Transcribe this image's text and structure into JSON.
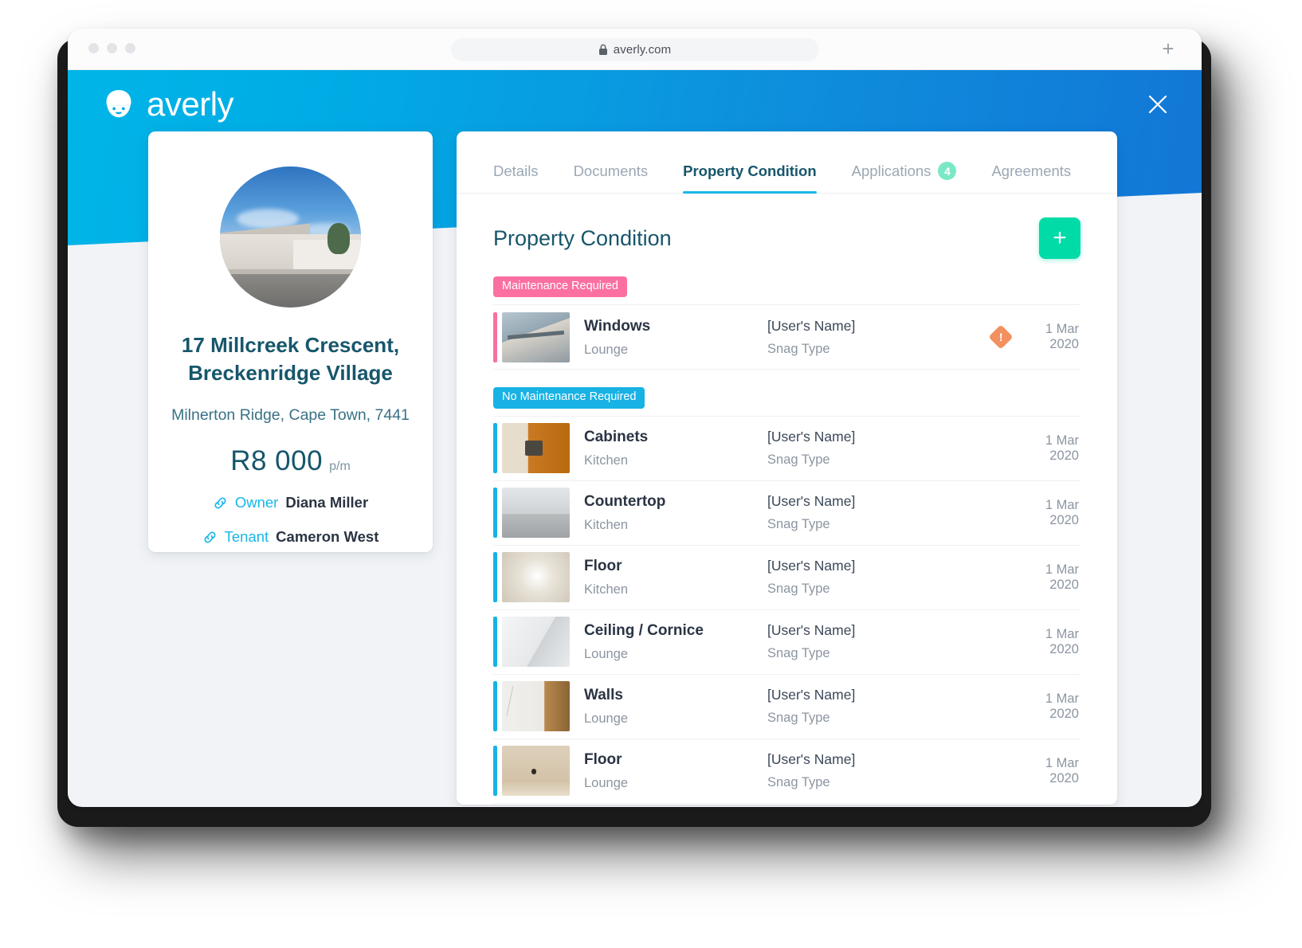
{
  "browser": {
    "url": "averly.com",
    "lock_icon": "lock-icon",
    "new_tab_label": "+",
    "traffic_lights": [
      "close",
      "minimize",
      "maximize"
    ]
  },
  "header": {
    "brand_name": "averly",
    "brand_icon": "averly-face-logo-icon",
    "close_icon": "close-icon",
    "gradient_from": "#00b5e8",
    "gradient_to": "#1276d6"
  },
  "property_card": {
    "photo_icon": "property-photo",
    "address": "17 Millcreek Crescent, Breckenridge Village",
    "locality": "Milnerton Ridge, Cape Town, 7441",
    "price": "R8 000",
    "price_period": "p/m",
    "people": [
      {
        "icon": "link-icon",
        "role": "Owner",
        "name": "Diana Miller"
      },
      {
        "icon": "link-icon",
        "role": "Tenant",
        "name": "Cameron West"
      }
    ]
  },
  "tabs": [
    {
      "label": "Details",
      "active": false,
      "badge": null
    },
    {
      "label": "Documents",
      "active": false,
      "badge": null
    },
    {
      "label": "Property Condition",
      "active": true,
      "badge": null
    },
    {
      "label": "Applications",
      "active": false,
      "badge": "4"
    },
    {
      "label": "Agreements",
      "active": false,
      "badge": null
    }
  ],
  "section": {
    "title": "Property Condition",
    "add_button_label": "+",
    "add_button_icon": "plus-icon",
    "add_button_color": "#00dba8"
  },
  "groups": [
    {
      "badge_label": "Maintenance Required",
      "badge_color": "#fb6fa1",
      "accent": "pink",
      "rows": [
        {
          "thumb": "th-windows",
          "title": "Windows",
          "subtitle": "Lounge",
          "user": "[User's Name]",
          "snag": "Snag Type",
          "alert": true,
          "alert_icon": "warning-diamond-icon",
          "date": "1 Mar 2020"
        }
      ]
    },
    {
      "badge_label": "No Maintenance Required",
      "badge_color": "#18b2e4",
      "accent": "blue",
      "rows": [
        {
          "thumb": "th-cabinets",
          "title": "Cabinets",
          "subtitle": "Kitchen",
          "user": "[User's Name]",
          "snag": "Snag Type",
          "alert": false,
          "date": "1 Mar 2020"
        },
        {
          "thumb": "th-countertop",
          "title": "Countertop",
          "subtitle": "Kitchen",
          "user": "[User's Name]",
          "snag": "Snag Type",
          "alert": false,
          "date": "1 Mar 2020"
        },
        {
          "thumb": "th-floor-k",
          "title": "Floor",
          "subtitle": "Kitchen",
          "user": "[User's Name]",
          "snag": "Snag Type",
          "alert": false,
          "date": "1 Mar 2020"
        },
        {
          "thumb": "th-ceiling",
          "title": "Ceiling / Cornice",
          "subtitle": "Lounge",
          "user": "[User's Name]",
          "snag": "Snag Type",
          "alert": false,
          "date": "1 Mar 2020"
        },
        {
          "thumb": "th-walls",
          "title": "Walls",
          "subtitle": "Lounge",
          "user": "[User's Name]",
          "snag": "Snag Type",
          "alert": false,
          "date": "1 Mar 2020"
        },
        {
          "thumb": "th-floor-l",
          "title": "Floor",
          "subtitle": "Lounge",
          "user": "[User's Name]",
          "snag": "Snag Type",
          "alert": false,
          "date": "1 Mar 2020"
        }
      ]
    }
  ]
}
